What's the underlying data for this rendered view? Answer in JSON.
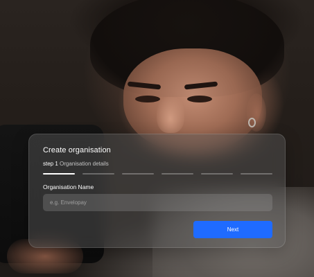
{
  "form": {
    "title": "Create organisation",
    "step_number": "step 1",
    "step_name": "Organisation details",
    "steps_total": 6,
    "current_step": 1,
    "field_label": "Organisation Name",
    "field_placeholder": "e.g. Envelopay",
    "field_value": "",
    "next_label": "Next"
  },
  "colors": {
    "accent": "#1f6bff",
    "card_bg": "rgba(95,95,95,0.42)",
    "text": "#ffffff"
  }
}
